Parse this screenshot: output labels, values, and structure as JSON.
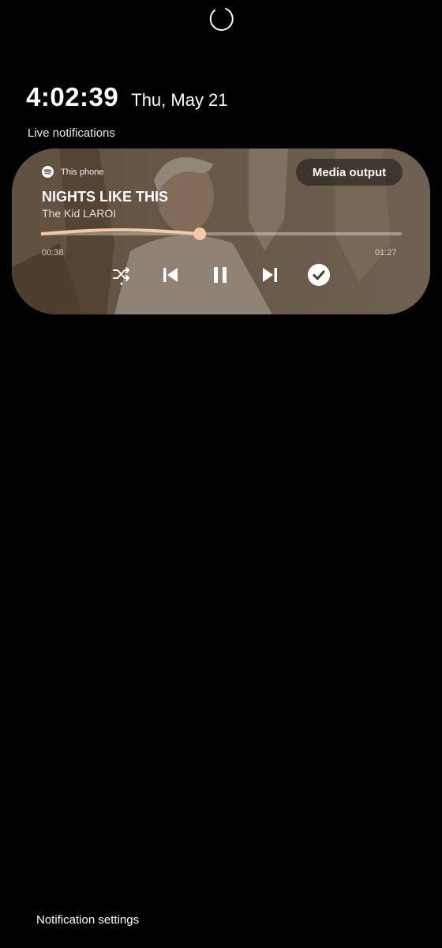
{
  "clock": {
    "time": "4:02:39",
    "date": "Thu, May 21"
  },
  "live_notifications": {
    "label": "Live notifications"
  },
  "media": {
    "source_app_icon": "spotify-icon",
    "source_device": "This phone",
    "media_output_label": "Media output",
    "title": "NIGHTS LIKE THIS",
    "artist": "The Kid LAROI",
    "elapsed": "00:38",
    "duration": "01:27",
    "progress_fraction": 0.44,
    "accent_color": "#f5c9a4",
    "controls": [
      "shuffle-icon",
      "previous-icon",
      "pause-icon",
      "next-icon",
      "checkmark-icon"
    ]
  },
  "footer": {
    "notification_settings_label": "Notification settings"
  }
}
